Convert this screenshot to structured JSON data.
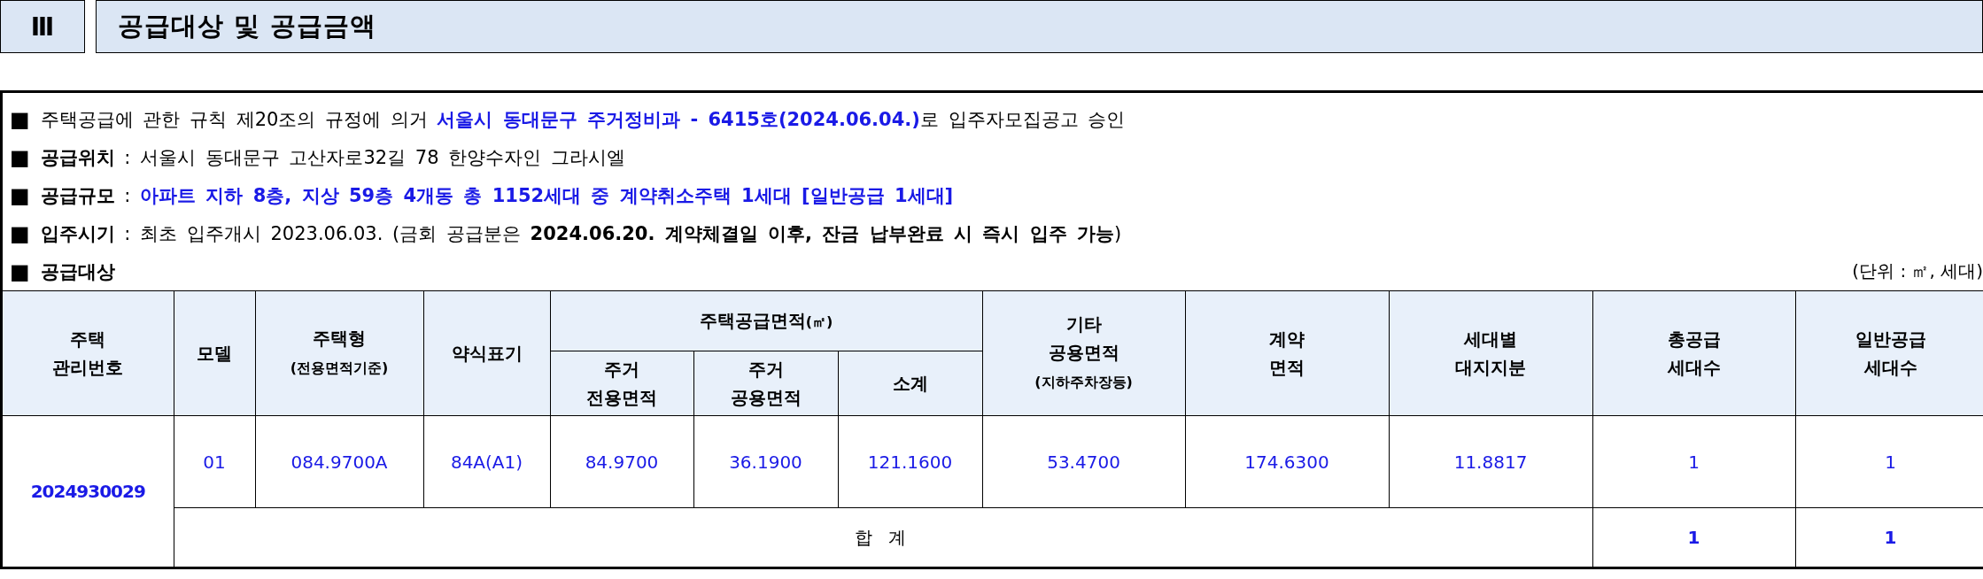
{
  "section": {
    "number": "Ⅲ",
    "title": "공급대상 및 공급금액"
  },
  "lines": [
    {
      "bullet": "■",
      "segments": [
        {
          "kind": "plain",
          "text": "주택공급에 관한 규칙 제20조의 규정에 의거 "
        },
        {
          "kind": "blue",
          "text": "서울시 동대문구 주거정비과 - 6415호(2024.06.04.)"
        },
        {
          "kind": "plain",
          "text": "로 입주자모집공고 승인"
        }
      ]
    },
    {
      "bullet": "■",
      "segments": [
        {
          "kind": "bold",
          "text": "공급위치"
        },
        {
          "kind": "plain",
          "text": " : 서울시 동대문구 고산자로32길 78 한양수자인 그라시엘"
        }
      ]
    },
    {
      "bullet": "■",
      "segments": [
        {
          "kind": "bold",
          "text": "공급규모"
        },
        {
          "kind": "plain",
          "text": " : "
        },
        {
          "kind": "blue",
          "text": "아파트 지하 8층, 지상 59층 4개동 총 1152세대 중 계약취소주택 1세대 [일반공급 1세대]"
        }
      ]
    },
    {
      "bullet": "■",
      "segments": [
        {
          "kind": "bold",
          "text": "입주시기"
        },
        {
          "kind": "plain",
          "text": " : 최초 입주개시 2023.06.03. (금회 공급분은 "
        },
        {
          "kind": "bold",
          "text": "2024.06.20. 계약체결일 이후, 잔금 납부완료 시 즉시 입주 가능"
        },
        {
          "kind": "plain",
          "text": ")"
        }
      ]
    },
    {
      "bullet": "■",
      "segments": [
        {
          "kind": "bold",
          "text": "공급대상"
        }
      ],
      "unit": "(단위 : ㎡, 세대)"
    }
  ],
  "table": {
    "header_top": [
      {
        "kind": "single",
        "lines": [
          "주택",
          "관리번호"
        ]
      },
      {
        "kind": "single",
        "lines": [
          "모델"
        ]
      },
      {
        "kind": "single",
        "lines": [
          "주택형"
        ],
        "note": "(전용면적기준)"
      },
      {
        "kind": "single",
        "lines": [
          "약식표기"
        ]
      },
      {
        "kind": "group",
        "lines": [
          "주택공급면적"
        ],
        "note": "(㎡)"
      },
      {
        "kind": "single",
        "lines": [
          "기타",
          "공용면적"
        ],
        "note": "(지하주차장등)"
      },
      {
        "kind": "single",
        "lines": [
          "계약",
          "면적"
        ]
      },
      {
        "kind": "single",
        "lines": [
          "세대별",
          "대지지분"
        ]
      },
      {
        "kind": "single",
        "lines": [
          "총공급",
          "세대수"
        ]
      },
      {
        "kind": "single",
        "lines": [
          "일반공급",
          "세대수"
        ]
      }
    ],
    "header_sub": [
      {
        "lines": [
          "주거",
          "전용면적"
        ]
      },
      {
        "lines": [
          "주거",
          "공용면적"
        ]
      },
      {
        "lines": [
          "소계"
        ]
      }
    ],
    "management_number": "2024930029",
    "row": [
      "01",
      "084.9700A",
      "84A(A1)",
      "84.9700",
      "36.1900",
      "121.1600",
      "53.4700",
      "174.6300",
      "11.8817",
      "1",
      "1"
    ],
    "total": {
      "label": "합 계",
      "values": [
        "1",
        "1"
      ]
    }
  }
}
